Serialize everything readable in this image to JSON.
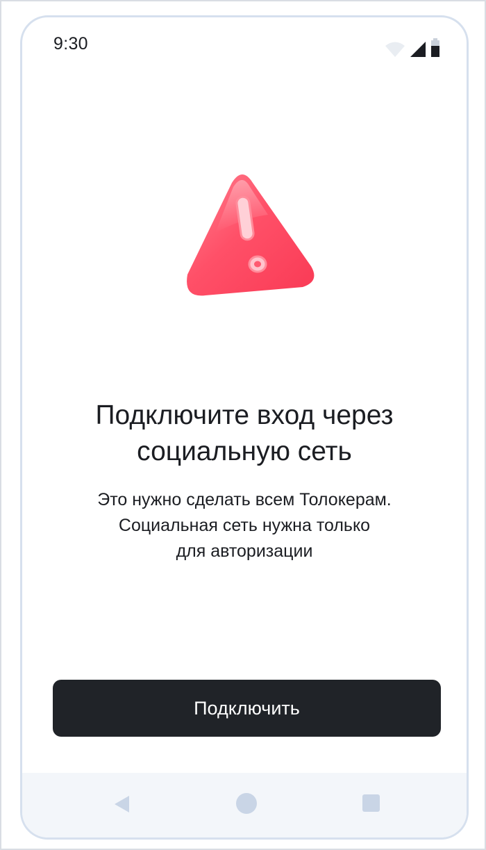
{
  "status_bar": {
    "time": "9:30",
    "icons": [
      "wifi-icon",
      "cellular-signal-icon",
      "battery-icon"
    ]
  },
  "illustration": {
    "icon": "warning-triangle-icon",
    "color": "#ff4d63"
  },
  "heading": {
    "line1": "Подключите вход через",
    "line2": "социальную сеть"
  },
  "description": {
    "line1": "Это нужно сделать всем Толокерам.",
    "line2": "Социальная сеть нужна только",
    "line3": "для авторизации"
  },
  "primary_button": {
    "label": "Подключить",
    "background": "#202328",
    "text_color": "#ffffff"
  },
  "navigation_bar": {
    "icons": [
      "back-icon",
      "home-icon",
      "recents-icon"
    ],
    "color": "#c9d5e6"
  }
}
